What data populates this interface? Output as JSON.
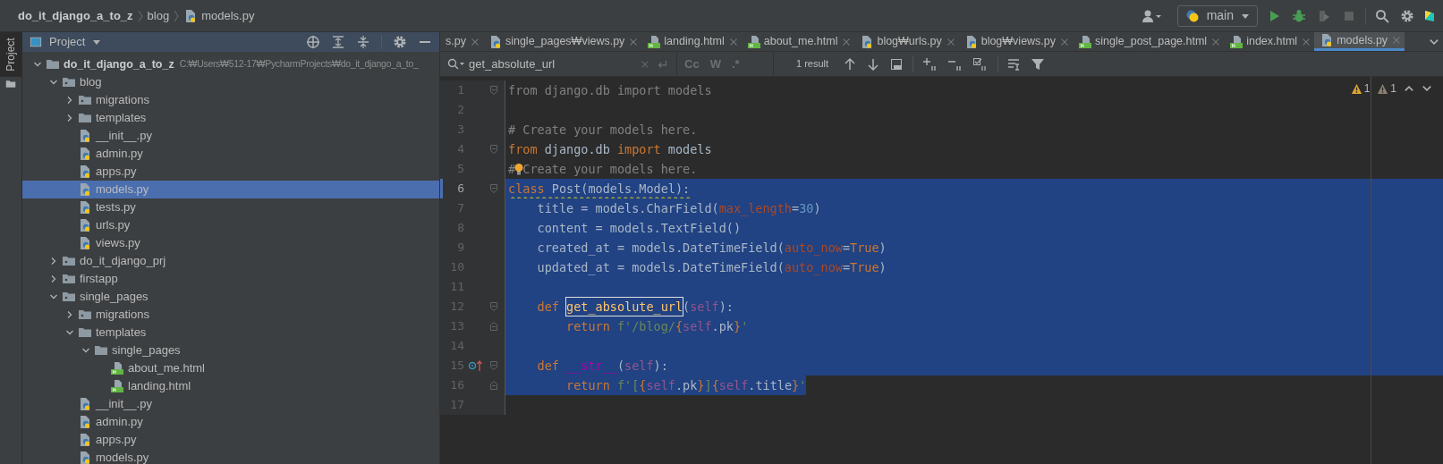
{
  "breadcrumb": [
    {
      "label": "do_it_django_a_to_z",
      "kind": "project"
    },
    {
      "label": "blog",
      "kind": "folder"
    },
    {
      "label": "models.py",
      "kind": "py"
    }
  ],
  "run_config": {
    "label": "main"
  },
  "project_panel": {
    "title": "Project",
    "side_label": "Project",
    "tree": [
      {
        "label": "do_it_django_a_to_z",
        "path": "C:₩Users₩512-17₩PycharmProjects₩do_it_django_a_to_",
        "kind": "folder",
        "expanded": true,
        "selected": false,
        "children": [
          {
            "label": "blog",
            "kind": "package",
            "expanded": true,
            "selected": false,
            "children": [
              {
                "label": "migrations",
                "kind": "package",
                "expanded": false,
                "selected": false
              },
              {
                "label": "templates",
                "kind": "folder",
                "expanded": false,
                "selected": false
              },
              {
                "label": "__init__.py",
                "kind": "py",
                "selected": false
              },
              {
                "label": "admin.py",
                "kind": "py",
                "selected": false
              },
              {
                "label": "apps.py",
                "kind": "py",
                "selected": false
              },
              {
                "label": "models.py",
                "kind": "py",
                "selected": true
              },
              {
                "label": "tests.py",
                "kind": "py",
                "selected": false
              },
              {
                "label": "urls.py",
                "kind": "py",
                "selected": false
              },
              {
                "label": "views.py",
                "kind": "py",
                "selected": false
              }
            ]
          },
          {
            "label": "do_it_django_prj",
            "kind": "package",
            "expanded": false,
            "selected": false
          },
          {
            "label": "firstapp",
            "kind": "package",
            "expanded": false,
            "selected": false
          },
          {
            "label": "single_pages",
            "kind": "package",
            "expanded": true,
            "selected": false,
            "children": [
              {
                "label": "migrations",
                "kind": "package",
                "expanded": false,
                "selected": false
              },
              {
                "label": "templates",
                "kind": "folder",
                "expanded": true,
                "selected": false,
                "children": [
                  {
                    "label": "single_pages",
                    "kind": "folder",
                    "expanded": true,
                    "selected": false,
                    "children": [
                      {
                        "label": "about_me.html",
                        "kind": "html",
                        "selected": false
                      },
                      {
                        "label": "landing.html",
                        "kind": "html",
                        "selected": false
                      }
                    ]
                  }
                ]
              },
              {
                "label": "__init__.py",
                "kind": "py",
                "selected": false
              },
              {
                "label": "admin.py",
                "kind": "py",
                "selected": false
              },
              {
                "label": "apps.py",
                "kind": "py",
                "selected": false
              },
              {
                "label": "models.py",
                "kind": "py",
                "selected": false
              }
            ]
          }
        ]
      }
    ]
  },
  "tabs": [
    {
      "label": "s.py",
      "kind": "cut",
      "selected": false
    },
    {
      "label": "single_pages₩views.py",
      "kind": "py",
      "selected": false
    },
    {
      "label": "landing.html",
      "kind": "html",
      "selected": false
    },
    {
      "label": "about_me.html",
      "kind": "html",
      "selected": false
    },
    {
      "label": "blog₩urls.py",
      "kind": "py",
      "selected": false
    },
    {
      "label": "blog₩views.py",
      "kind": "py",
      "selected": false
    },
    {
      "label": "single_post_page.html",
      "kind": "html",
      "selected": false
    },
    {
      "label": "index.html",
      "kind": "html",
      "selected": false
    },
    {
      "label": "models.py",
      "kind": "py",
      "selected": true
    }
  ],
  "search": {
    "value": "get_absolute_url",
    "toggles": [
      "Cc",
      "W",
      ".*"
    ],
    "result": "1 result"
  },
  "editor": {
    "warnings": [
      {
        "count": "1",
        "color": "#e0a82e"
      },
      {
        "count": "1",
        "color": "#8c8272"
      }
    ],
    "lines": [
      {
        "number": "1",
        "selected": false,
        "current": false,
        "gutter": [
          {
            "kind": "fold_start"
          }
        ],
        "tokens": [
          {
            "kind": "unused",
            "text": "from django.db import models"
          }
        ]
      },
      {
        "number": "2",
        "current": false
      },
      {
        "number": "3",
        "selected": false,
        "current": false,
        "tokens": [
          {
            "kind": "comment",
            "text": "# Create your models here."
          }
        ]
      },
      {
        "number": "4",
        "selected": false,
        "current": false,
        "gutter": [
          {
            "kind": "fold_start"
          }
        ],
        "tokens": [
          {
            "kind": "keyword",
            "text": "from"
          },
          {
            "kind": "plain",
            "text": " django.db "
          },
          {
            "kind": "keyword",
            "text": "import"
          },
          {
            "kind": "plain",
            "text": " models"
          }
        ]
      },
      {
        "number": "5",
        "selected": false,
        "current": false,
        "tokens": [
          {
            "kind": "comment",
            "text": "#"
          },
          {
            "kind": "bulb"
          },
          {
            "kind": "comment",
            "text": "Create your models here."
          }
        ]
      },
      {
        "number": "6",
        "selected": true,
        "current": true,
        "gutter": [
          {
            "kind": "fold_start"
          }
        ],
        "warning": true,
        "tokens": [
          {
            "kind": "keyword",
            "text": "class "
          },
          {
            "kind": "plain",
            "text": "Post(models.Model):"
          }
        ]
      },
      {
        "number": "7",
        "selected": true,
        "current": false,
        "tokens": [
          {
            "kind": "plain",
            "text": "    title = models.CharField("
          },
          {
            "kind": "param",
            "text": "max_length"
          },
          {
            "kind": "plain",
            "text": "="
          },
          {
            "kind": "number",
            "text": "30"
          },
          {
            "kind": "plain",
            "text": ")"
          }
        ]
      },
      {
        "number": "8",
        "selected": true,
        "current": false,
        "tokens": [
          {
            "kind": "plain",
            "text": "    content = models.TextField()"
          }
        ]
      },
      {
        "number": "9",
        "selected": true,
        "current": false,
        "tokens": [
          {
            "kind": "plain",
            "text": "    created_at = models.DateTimeField("
          },
          {
            "kind": "param",
            "text": "auto_now"
          },
          {
            "kind": "plain",
            "text": "="
          },
          {
            "kind": "keyword",
            "text": "True"
          },
          {
            "kind": "plain",
            "text": ")"
          }
        ]
      },
      {
        "number": "10",
        "selected": true,
        "current": false,
        "tokens": [
          {
            "kind": "plain",
            "text": "    updated_at = models.DateTimeField("
          },
          {
            "kind": "param",
            "text": "auto_now"
          },
          {
            "kind": "plain",
            "text": "="
          },
          {
            "kind": "keyword",
            "text": "True"
          },
          {
            "kind": "plain",
            "text": ")"
          }
        ]
      },
      {
        "number": "11",
        "selected": true,
        "current": false
      },
      {
        "number": "12",
        "selected": true,
        "current": false,
        "gutter": [
          {
            "kind": "fold_start"
          }
        ],
        "tokens": [
          {
            "kind": "keyword",
            "text": "    def "
          },
          {
            "kind": "match",
            "text": "get_absolute_url"
          },
          {
            "kind": "plain",
            "text": "("
          },
          {
            "kind": "self",
            "text": "self"
          },
          {
            "kind": "plain",
            "text": "):"
          }
        ]
      },
      {
        "number": "13",
        "selected": true,
        "current": false,
        "gutter": [
          {
            "kind": "fold_end"
          }
        ],
        "tokens": [
          {
            "kind": "keyword",
            "text": "        return "
          },
          {
            "kind": "string",
            "text": "f'/blog/"
          },
          {
            "kind": "keyword",
            "text": "{"
          },
          {
            "kind": "self",
            "text": "self"
          },
          {
            "kind": "plain",
            "text": ".pk"
          },
          {
            "kind": "keyword",
            "text": "}"
          },
          {
            "kind": "string",
            "text": "'"
          }
        ]
      },
      {
        "number": "14",
        "selected": true,
        "current": false
      },
      {
        "number": "15",
        "selected": true,
        "current": false,
        "gutter": [
          {
            "kind": "override"
          },
          {
            "kind": "fold_start"
          }
        ],
        "tokens": [
          {
            "kind": "keyword",
            "text": "    def "
          },
          {
            "kind": "magic",
            "text": "__str__"
          },
          {
            "kind": "plain",
            "text": "("
          },
          {
            "kind": "self",
            "text": "self"
          },
          {
            "kind": "plain",
            "text": "):"
          }
        ]
      },
      {
        "number": "16",
        "selected": true,
        "current": false,
        "gutter": [
          {
            "kind": "fold_end"
          }
        ],
        "tokens": [
          {
            "kind": "keyword",
            "text": "        return "
          },
          {
            "kind": "string",
            "text": "f'["
          },
          {
            "kind": "keyword",
            "text": "{"
          },
          {
            "kind": "self",
            "text": "self"
          },
          {
            "kind": "plain",
            "text": ".pk"
          },
          {
            "kind": "keyword",
            "text": "}"
          },
          {
            "kind": "string",
            "text": "]"
          },
          {
            "kind": "keyword",
            "text": "{"
          },
          {
            "kind": "self",
            "text": "self"
          },
          {
            "kind": "plain",
            "text": ".title"
          },
          {
            "kind": "keyword",
            "text": "}"
          },
          {
            "kind": "string",
            "text": "'"
          }
        ]
      },
      {
        "number": "17",
        "current": false
      }
    ]
  }
}
